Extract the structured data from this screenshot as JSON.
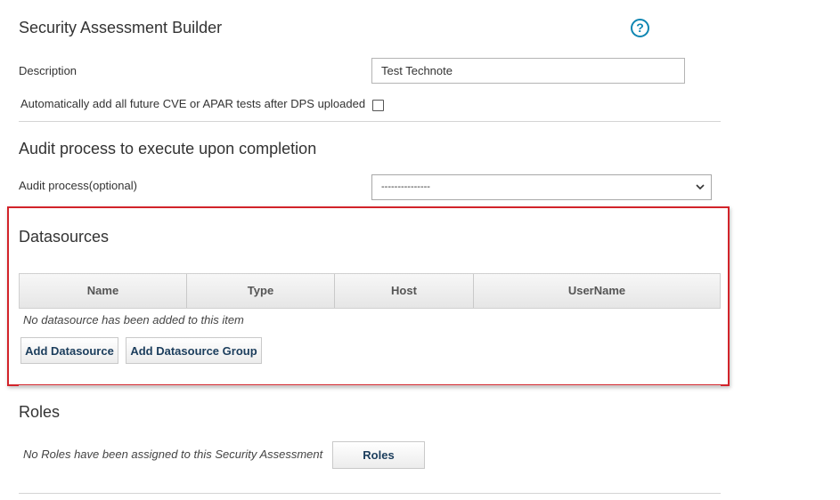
{
  "header": {
    "title": "Security Assessment Builder",
    "help_icon": "question-circle-icon"
  },
  "description": {
    "label": "Description",
    "value": "Test Technote"
  },
  "auto_add": {
    "label": "Automatically add all future CVE or APAR tests after DPS uploaded",
    "checked": false
  },
  "audit": {
    "section_title": "Audit process to execute upon completion",
    "label": "Audit process(optional)",
    "selected": "---------------"
  },
  "datasources": {
    "section_title": "Datasources",
    "columns": [
      "Name",
      "Type",
      "Host",
      "UserName"
    ],
    "empty_message": "No datasource has been added to this item",
    "add_button": "Add Datasource",
    "add_group_button": "Add Datasource Group",
    "highlight_color": "#d2232a"
  },
  "roles": {
    "section_title": "Roles",
    "empty_message": "No Roles have been assigned to this Security Assessment",
    "button": "Roles"
  },
  "colors": {
    "accent": "#0e86b2",
    "button_text": "#1b3d5c"
  }
}
